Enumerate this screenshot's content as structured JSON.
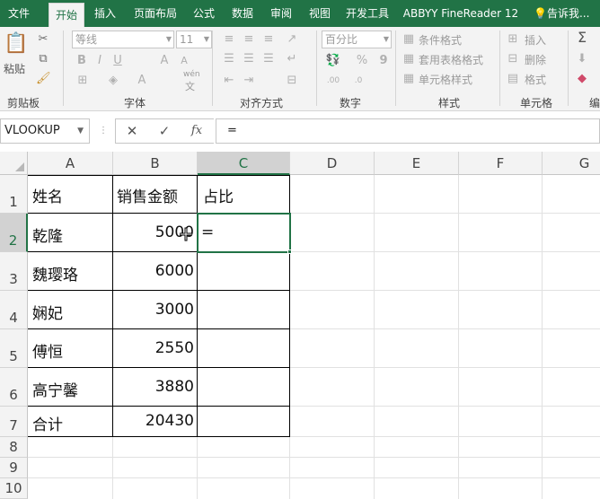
{
  "tabs": [
    {
      "label": "文件",
      "active": false
    },
    {
      "label": "开始",
      "active": true
    },
    {
      "label": "插入",
      "active": false
    },
    {
      "label": "页面布局",
      "active": false
    },
    {
      "label": "公式",
      "active": false
    },
    {
      "label": "数据",
      "active": false
    },
    {
      "label": "审阅",
      "active": false
    },
    {
      "label": "视图",
      "active": false
    },
    {
      "label": "开发工具",
      "active": false
    },
    {
      "label": "ABBYY FineReader 12",
      "active": false
    }
  ],
  "tell_me": "告诉我...",
  "ribbon": {
    "clipboard": {
      "label": "剪贴板",
      "paste_label": "粘贴"
    },
    "font": {
      "label": "字体",
      "font_name": "等线",
      "font_size": "11",
      "bold": "B",
      "italic": "I",
      "underline": "U",
      "grow": "A",
      "shrink": "A",
      "phonetic": "wén",
      "phonetic_char": "文"
    },
    "alignment": {
      "label": "对齐方式"
    },
    "number": {
      "label": "数字",
      "format": "百分比",
      "percent": "%",
      "comma": "9"
    },
    "styles": {
      "label": "样式",
      "conditional": "条件格式",
      "table": "套用表格格式",
      "cell_styles": "单元格样式"
    },
    "cells": {
      "label": "单元格",
      "insert": "插入",
      "delete": "删除",
      "format": "格式"
    },
    "editing": {
      "label": "编"
    }
  },
  "formula_bar": {
    "name_box": "VLOOKUP",
    "fx": "fx",
    "formula": "="
  },
  "columns": [
    "A",
    "B",
    "C",
    "D",
    "E",
    "F",
    "G"
  ],
  "selected_column": "C",
  "rows": [
    "1",
    "2",
    "3",
    "4",
    "5",
    "6",
    "7",
    "8",
    "9",
    "10"
  ],
  "selected_row": "2",
  "table": {
    "header": {
      "name": "姓名",
      "amount": "销售金额",
      "ratio": "占比"
    },
    "records": [
      {
        "name": "乾隆",
        "amount": "5000",
        "ratio": "="
      },
      {
        "name": "魏璎珞",
        "amount": "6000",
        "ratio": ""
      },
      {
        "name": "娴妃",
        "amount": "3000",
        "ratio": ""
      },
      {
        "name": "傅恒",
        "amount": "2550",
        "ratio": ""
      },
      {
        "name": "高宁馨",
        "amount": "3880",
        "ratio": ""
      },
      {
        "name": "合计",
        "amount": "20430",
        "ratio": ""
      }
    ]
  },
  "colors": {
    "accent": "#217346"
  }
}
